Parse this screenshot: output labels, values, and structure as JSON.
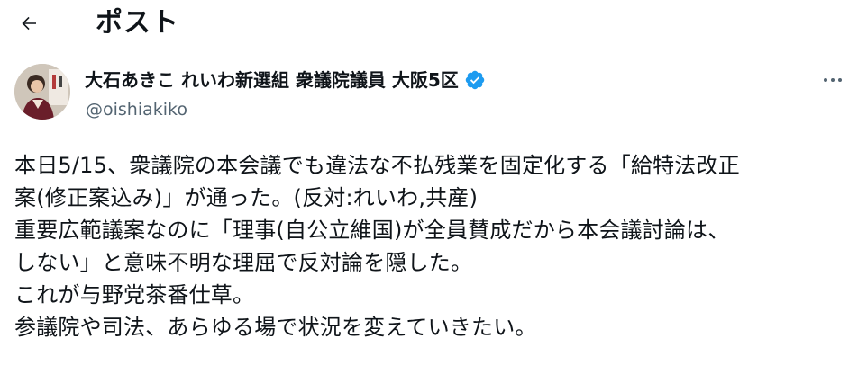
{
  "header": {
    "title": "ポスト",
    "back_icon": "arrow-left-icon"
  },
  "author": {
    "display_name": "大石あきこ れいわ新選組 衆議院議員 大阪5区",
    "handle": "@oishiakiko",
    "verified": true,
    "verified_color": "#1d9bf0",
    "verified_icon": "verified-badge-icon",
    "more_icon": "more-horizontal-icon"
  },
  "tweet": {
    "lines": [
      "本日5/15、衆議院の本会議でも違法な不払残業を固定化する「給特法改正",
      "案(修正案込み)」が通った。(反対:れいわ,共産)",
      "重要広範議案なのに「理事(自公立維国)が全員賛成だから本会議討論は、",
      "しない」と意味不明な理屈で反対論を隠した。",
      "これが与野党茶番仕草。",
      "参議院や司法、あらゆる場で状況を変えていきたい。"
    ]
  }
}
